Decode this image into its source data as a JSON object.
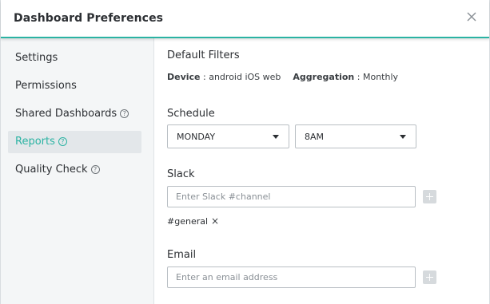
{
  "modal": {
    "title": "Dashboard Preferences",
    "close_icon": "close-icon"
  },
  "sidebar": {
    "items": [
      {
        "label": "Settings",
        "help": false,
        "active": false
      },
      {
        "label": "Permissions",
        "help": false,
        "active": false
      },
      {
        "label": "Shared Dashboards",
        "help": true,
        "active": false
      },
      {
        "label": "Reports",
        "help": true,
        "active": true
      },
      {
        "label": "Quality Check",
        "help": true,
        "active": false
      }
    ],
    "help_glyph": "?"
  },
  "filters": {
    "title": "Default Filters",
    "device_label": "Device",
    "device_value": ": android iOS web",
    "aggregation_label": "Aggregation",
    "aggregation_value": ": Monthly"
  },
  "schedule": {
    "title": "Schedule",
    "day": "MONDAY",
    "time": "8AM"
  },
  "slack": {
    "title": "Slack",
    "placeholder": "Enter Slack #channel",
    "tags": [
      "#general"
    ],
    "remove_glyph": "×"
  },
  "email": {
    "title": "Email",
    "placeholder": "Enter an email address"
  },
  "colors": {
    "accent": "#2bb3a3",
    "sidebar_bg": "#f4f6f7",
    "active_item_bg": "#e3e7ea",
    "add_button": "#d6dadd"
  }
}
